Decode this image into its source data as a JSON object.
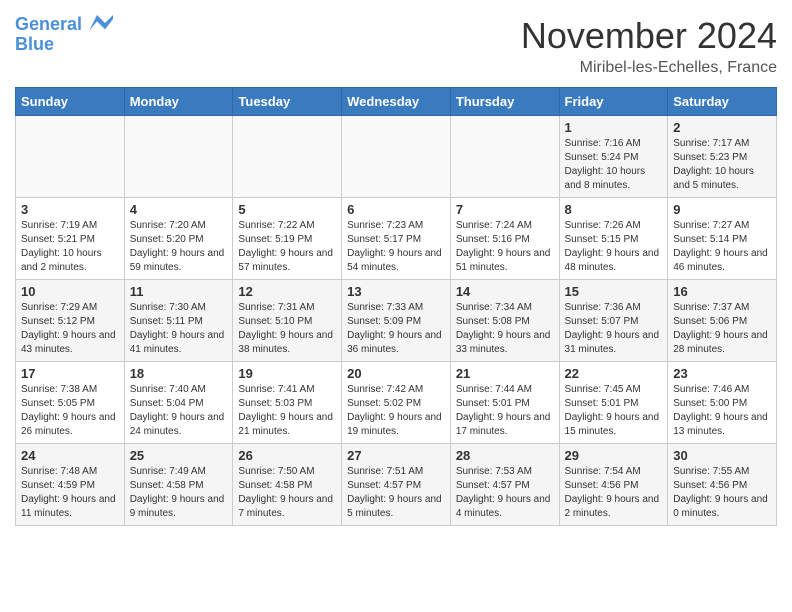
{
  "header": {
    "logo_line1": "General",
    "logo_line2": "Blue",
    "month": "November 2024",
    "location": "Miribel-les-Echelles, France"
  },
  "weekdays": [
    "Sunday",
    "Monday",
    "Tuesday",
    "Wednesday",
    "Thursday",
    "Friday",
    "Saturday"
  ],
  "weeks": [
    [
      {
        "day": "",
        "info": ""
      },
      {
        "day": "",
        "info": ""
      },
      {
        "day": "",
        "info": ""
      },
      {
        "day": "",
        "info": ""
      },
      {
        "day": "",
        "info": ""
      },
      {
        "day": "1",
        "info": "Sunrise: 7:16 AM\nSunset: 5:24 PM\nDaylight: 10 hours and 8 minutes."
      },
      {
        "day": "2",
        "info": "Sunrise: 7:17 AM\nSunset: 5:23 PM\nDaylight: 10 hours and 5 minutes."
      }
    ],
    [
      {
        "day": "3",
        "info": "Sunrise: 7:19 AM\nSunset: 5:21 PM\nDaylight: 10 hours and 2 minutes."
      },
      {
        "day": "4",
        "info": "Sunrise: 7:20 AM\nSunset: 5:20 PM\nDaylight: 9 hours and 59 minutes."
      },
      {
        "day": "5",
        "info": "Sunrise: 7:22 AM\nSunset: 5:19 PM\nDaylight: 9 hours and 57 minutes."
      },
      {
        "day": "6",
        "info": "Sunrise: 7:23 AM\nSunset: 5:17 PM\nDaylight: 9 hours and 54 minutes."
      },
      {
        "day": "7",
        "info": "Sunrise: 7:24 AM\nSunset: 5:16 PM\nDaylight: 9 hours and 51 minutes."
      },
      {
        "day": "8",
        "info": "Sunrise: 7:26 AM\nSunset: 5:15 PM\nDaylight: 9 hours and 48 minutes."
      },
      {
        "day": "9",
        "info": "Sunrise: 7:27 AM\nSunset: 5:14 PM\nDaylight: 9 hours and 46 minutes."
      }
    ],
    [
      {
        "day": "10",
        "info": "Sunrise: 7:29 AM\nSunset: 5:12 PM\nDaylight: 9 hours and 43 minutes."
      },
      {
        "day": "11",
        "info": "Sunrise: 7:30 AM\nSunset: 5:11 PM\nDaylight: 9 hours and 41 minutes."
      },
      {
        "day": "12",
        "info": "Sunrise: 7:31 AM\nSunset: 5:10 PM\nDaylight: 9 hours and 38 minutes."
      },
      {
        "day": "13",
        "info": "Sunrise: 7:33 AM\nSunset: 5:09 PM\nDaylight: 9 hours and 36 minutes."
      },
      {
        "day": "14",
        "info": "Sunrise: 7:34 AM\nSunset: 5:08 PM\nDaylight: 9 hours and 33 minutes."
      },
      {
        "day": "15",
        "info": "Sunrise: 7:36 AM\nSunset: 5:07 PM\nDaylight: 9 hours and 31 minutes."
      },
      {
        "day": "16",
        "info": "Sunrise: 7:37 AM\nSunset: 5:06 PM\nDaylight: 9 hours and 28 minutes."
      }
    ],
    [
      {
        "day": "17",
        "info": "Sunrise: 7:38 AM\nSunset: 5:05 PM\nDaylight: 9 hours and 26 minutes."
      },
      {
        "day": "18",
        "info": "Sunrise: 7:40 AM\nSunset: 5:04 PM\nDaylight: 9 hours and 24 minutes."
      },
      {
        "day": "19",
        "info": "Sunrise: 7:41 AM\nSunset: 5:03 PM\nDaylight: 9 hours and 21 minutes."
      },
      {
        "day": "20",
        "info": "Sunrise: 7:42 AM\nSunset: 5:02 PM\nDaylight: 9 hours and 19 minutes."
      },
      {
        "day": "21",
        "info": "Sunrise: 7:44 AM\nSunset: 5:01 PM\nDaylight: 9 hours and 17 minutes."
      },
      {
        "day": "22",
        "info": "Sunrise: 7:45 AM\nSunset: 5:01 PM\nDaylight: 9 hours and 15 minutes."
      },
      {
        "day": "23",
        "info": "Sunrise: 7:46 AM\nSunset: 5:00 PM\nDaylight: 9 hours and 13 minutes."
      }
    ],
    [
      {
        "day": "24",
        "info": "Sunrise: 7:48 AM\nSunset: 4:59 PM\nDaylight: 9 hours and 11 minutes."
      },
      {
        "day": "25",
        "info": "Sunrise: 7:49 AM\nSunset: 4:58 PM\nDaylight: 9 hours and 9 minutes."
      },
      {
        "day": "26",
        "info": "Sunrise: 7:50 AM\nSunset: 4:58 PM\nDaylight: 9 hours and 7 minutes."
      },
      {
        "day": "27",
        "info": "Sunrise: 7:51 AM\nSunset: 4:57 PM\nDaylight: 9 hours and 5 minutes."
      },
      {
        "day": "28",
        "info": "Sunrise: 7:53 AM\nSunset: 4:57 PM\nDaylight: 9 hours and 4 minutes."
      },
      {
        "day": "29",
        "info": "Sunrise: 7:54 AM\nSunset: 4:56 PM\nDaylight: 9 hours and 2 minutes."
      },
      {
        "day": "30",
        "info": "Sunrise: 7:55 AM\nSunset: 4:56 PM\nDaylight: 9 hours and 0 minutes."
      }
    ]
  ]
}
